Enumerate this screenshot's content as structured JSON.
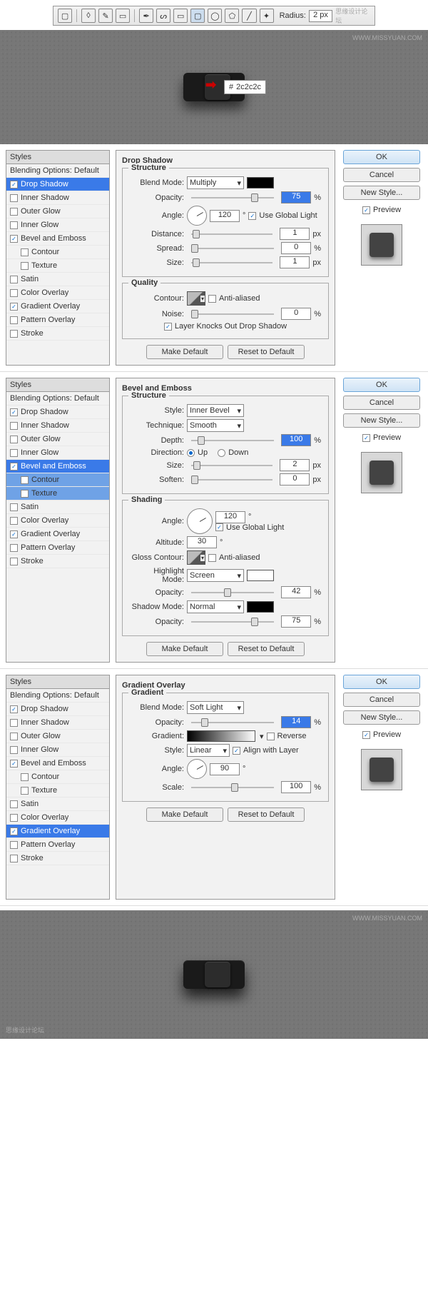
{
  "watermark": "WWW.MISSYUAN.COM",
  "watermark_cn": "思缘设计论坛",
  "toolbar": {
    "radius_label": "Radius:",
    "radius_value": "2 px"
  },
  "color": {
    "hash": "#",
    "value": "2c2c2c"
  },
  "styles_header": "Styles",
  "blending_opts": "Blending Options: Default",
  "effects": {
    "drop_shadow": "Drop Shadow",
    "inner_shadow": "Inner Shadow",
    "outer_glow": "Outer Glow",
    "inner_glow": "Inner Glow",
    "bevel": "Bevel and Emboss",
    "contour": "Contour",
    "texture": "Texture",
    "satin": "Satin",
    "color_overlay": "Color Overlay",
    "gradient_overlay": "Gradient Overlay",
    "pattern_overlay": "Pattern Overlay",
    "stroke": "Stroke"
  },
  "buttons": {
    "ok": "OK",
    "cancel": "Cancel",
    "new_style": "New Style...",
    "preview": "Preview",
    "make_default": "Make Default",
    "reset": "Reset to Default"
  },
  "labels": {
    "blend_mode": "Blend Mode:",
    "opacity": "Opacity:",
    "angle": "Angle:",
    "distance": "Distance:",
    "spread": "Spread:",
    "size": "Size:",
    "contour": "Contour:",
    "noise": "Noise:",
    "anti": "Anti-aliased",
    "knockout": "Layer Knocks Out Drop Shadow",
    "use_global": "Use Global Light",
    "style": "Style:",
    "technique": "Technique:",
    "depth": "Depth:",
    "direction": "Direction:",
    "up": "Up",
    "down": "Down",
    "soften": "Soften:",
    "altitude": "Altitude:",
    "gloss": "Gloss Contour:",
    "highlight": "Highlight Mode:",
    "shadow_mode": "Shadow Mode:",
    "gradient": "Gradient:",
    "reverse": "Reverse",
    "align": "Align with Layer",
    "scale": "Scale:",
    "structure": "Structure",
    "quality": "Quality",
    "shading": "Shading",
    "gradient_grp": "Gradient"
  },
  "groups": {
    "drop_shadow": "Drop Shadow",
    "bevel": "Bevel and Emboss",
    "gradient": "Gradient Overlay"
  },
  "units": {
    "pct": "%",
    "px": "px",
    "deg": "°"
  },
  "panel1": {
    "blend_mode": "Multiply",
    "opacity": "75",
    "angle": "120",
    "distance": "1",
    "spread": "0",
    "size": "1",
    "noise": "0"
  },
  "panel2": {
    "style": "Inner Bevel",
    "technique": "Smooth",
    "depth": "100",
    "size": "2",
    "soften": "0",
    "angle": "120",
    "altitude": "30",
    "highlight": "Screen",
    "h_opacity": "42",
    "shadow": "Normal",
    "s_opacity": "75"
  },
  "panel3": {
    "blend_mode": "Soft Light",
    "opacity": "14",
    "style": "Linear",
    "angle": "90",
    "scale": "100"
  }
}
